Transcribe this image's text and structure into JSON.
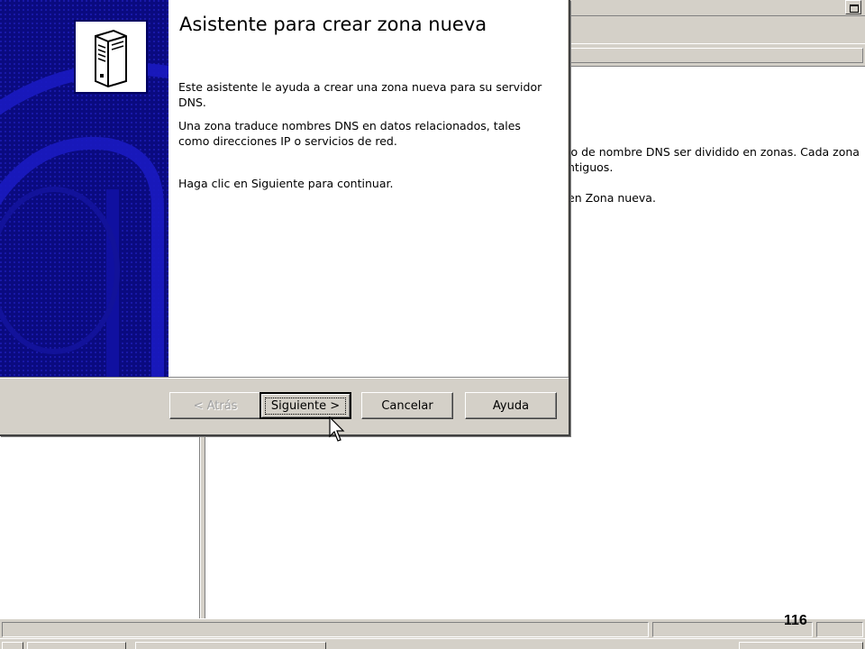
{
  "wizard": {
    "title": "Asistente para crear zona nueva",
    "paragraphs": {
      "p1": "Este asistente le ayuda a crear una zona nueva para su servidor DNS.",
      "p2": "Una zona traduce nombres DNS en datos relacionados, tales como direcciones IP o servicios de red.",
      "p3": "Haga clic en Siguiente para continuar."
    },
    "icon": "server-icon",
    "buttons": {
      "back": "< Atrás",
      "next": "Siguiente >",
      "cancel": "Cancelar",
      "help": "Ayuda"
    },
    "colors": {
      "banner": "#0a0a80",
      "dialog_face": "#d4d0c8"
    }
  },
  "background": {
    "right_pane": {
      "line1": "io de nombre DNS ser dividido en zonas. Cada zona",
      "line2": "ntiguos.",
      "line3": "en Zona nueva."
    }
  },
  "page_number": "116"
}
